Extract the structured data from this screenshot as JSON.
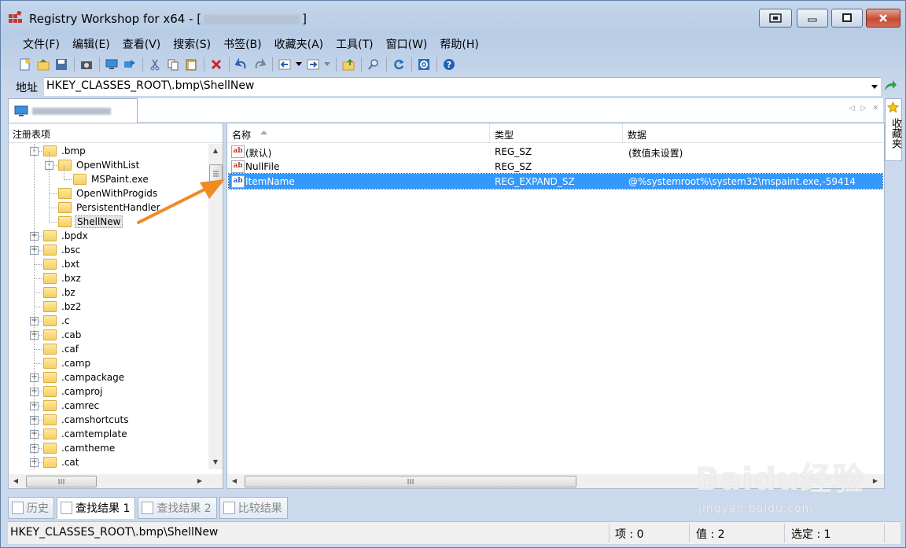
{
  "window": {
    "title": "Registry Workshop for x64 - [",
    "title_suffix": "]",
    "controls": [
      "restore-layout",
      "minimize",
      "maximize",
      "close"
    ]
  },
  "menu": [
    "文件(F)",
    "编辑(E)",
    "查看(V)",
    "搜索(S)",
    "书签(B)",
    "收藏夹(A)",
    "工具(T)",
    "窗口(W)",
    "帮助(H)"
  ],
  "address": {
    "label": "地址",
    "value": "HKEY_CLASSES_ROOT\\.bmp\\ShellNew"
  },
  "favorites_tab": "收藏夹",
  "tree": {
    "header": "注册表项",
    "items": [
      {
        "label": ".bmp",
        "level": 0,
        "expander": "-"
      },
      {
        "label": "OpenWithList",
        "level": 1,
        "expander": "-"
      },
      {
        "label": "MSPaint.exe",
        "level": 2,
        "expander": ""
      },
      {
        "label": "OpenWithProgids",
        "level": 1,
        "expander": ""
      },
      {
        "label": "PersistentHandler",
        "level": 1,
        "expander": ""
      },
      {
        "label": "ShellNew",
        "level": 1,
        "expander": "",
        "selected": true
      },
      {
        "label": ".bpdx",
        "level": 0,
        "expander": "+"
      },
      {
        "label": ".bsc",
        "level": 0,
        "expander": "+"
      },
      {
        "label": ".bxt",
        "level": 0,
        "expander": ""
      },
      {
        "label": ".bxz",
        "level": 0,
        "expander": ""
      },
      {
        "label": ".bz",
        "level": 0,
        "expander": ""
      },
      {
        "label": ".bz2",
        "level": 0,
        "expander": ""
      },
      {
        "label": ".c",
        "level": 0,
        "expander": "+"
      },
      {
        "label": ".cab",
        "level": 0,
        "expander": "+"
      },
      {
        "label": ".caf",
        "level": 0,
        "expander": ""
      },
      {
        "label": ".camp",
        "level": 0,
        "expander": ""
      },
      {
        "label": ".campackage",
        "level": 0,
        "expander": "+"
      },
      {
        "label": ".camproj",
        "level": 0,
        "expander": "+"
      },
      {
        "label": ".camrec",
        "level": 0,
        "expander": "+"
      },
      {
        "label": ".camshortcuts",
        "level": 0,
        "expander": "+"
      },
      {
        "label": ".camtemplate",
        "level": 0,
        "expander": "+"
      },
      {
        "label": ".camtheme",
        "level": 0,
        "expander": "+"
      },
      {
        "label": ".cat",
        "level": 0,
        "expander": "+"
      }
    ]
  },
  "list": {
    "columns": [
      "名称",
      "类型",
      "数据"
    ],
    "rows": [
      {
        "name": "(默认)",
        "type": "REG_SZ",
        "data": "(数值未设置)",
        "icon": "string-value-icon"
      },
      {
        "name": "NullFile",
        "type": "REG_SZ",
        "data": "",
        "icon": "string-value-icon"
      },
      {
        "name": "ItemName",
        "type": "REG_EXPAND_SZ",
        "data": "@%systemroot%\\system32\\mspaint.exe,-59414",
        "icon": "expand-string-value-icon",
        "selected": true
      }
    ]
  },
  "bottom_tabs": [
    {
      "label": "历史",
      "active": false
    },
    {
      "label": "查找结果 1",
      "active": true
    },
    {
      "label": "查找结果 2",
      "active": false
    },
    {
      "label": "比较结果",
      "active": false
    }
  ],
  "status": {
    "path": "HKEY_CLASSES_ROOT\\.bmp\\ShellNew",
    "items": "项 : 0",
    "values": "值 : 2",
    "selected": "选定 : 1"
  },
  "watermark": {
    "main": "Baidu经验",
    "sub": "jingyan.baidu.com"
  },
  "colors": {
    "selection": "#3399ff",
    "annotation_arrow": "#f08a24"
  }
}
